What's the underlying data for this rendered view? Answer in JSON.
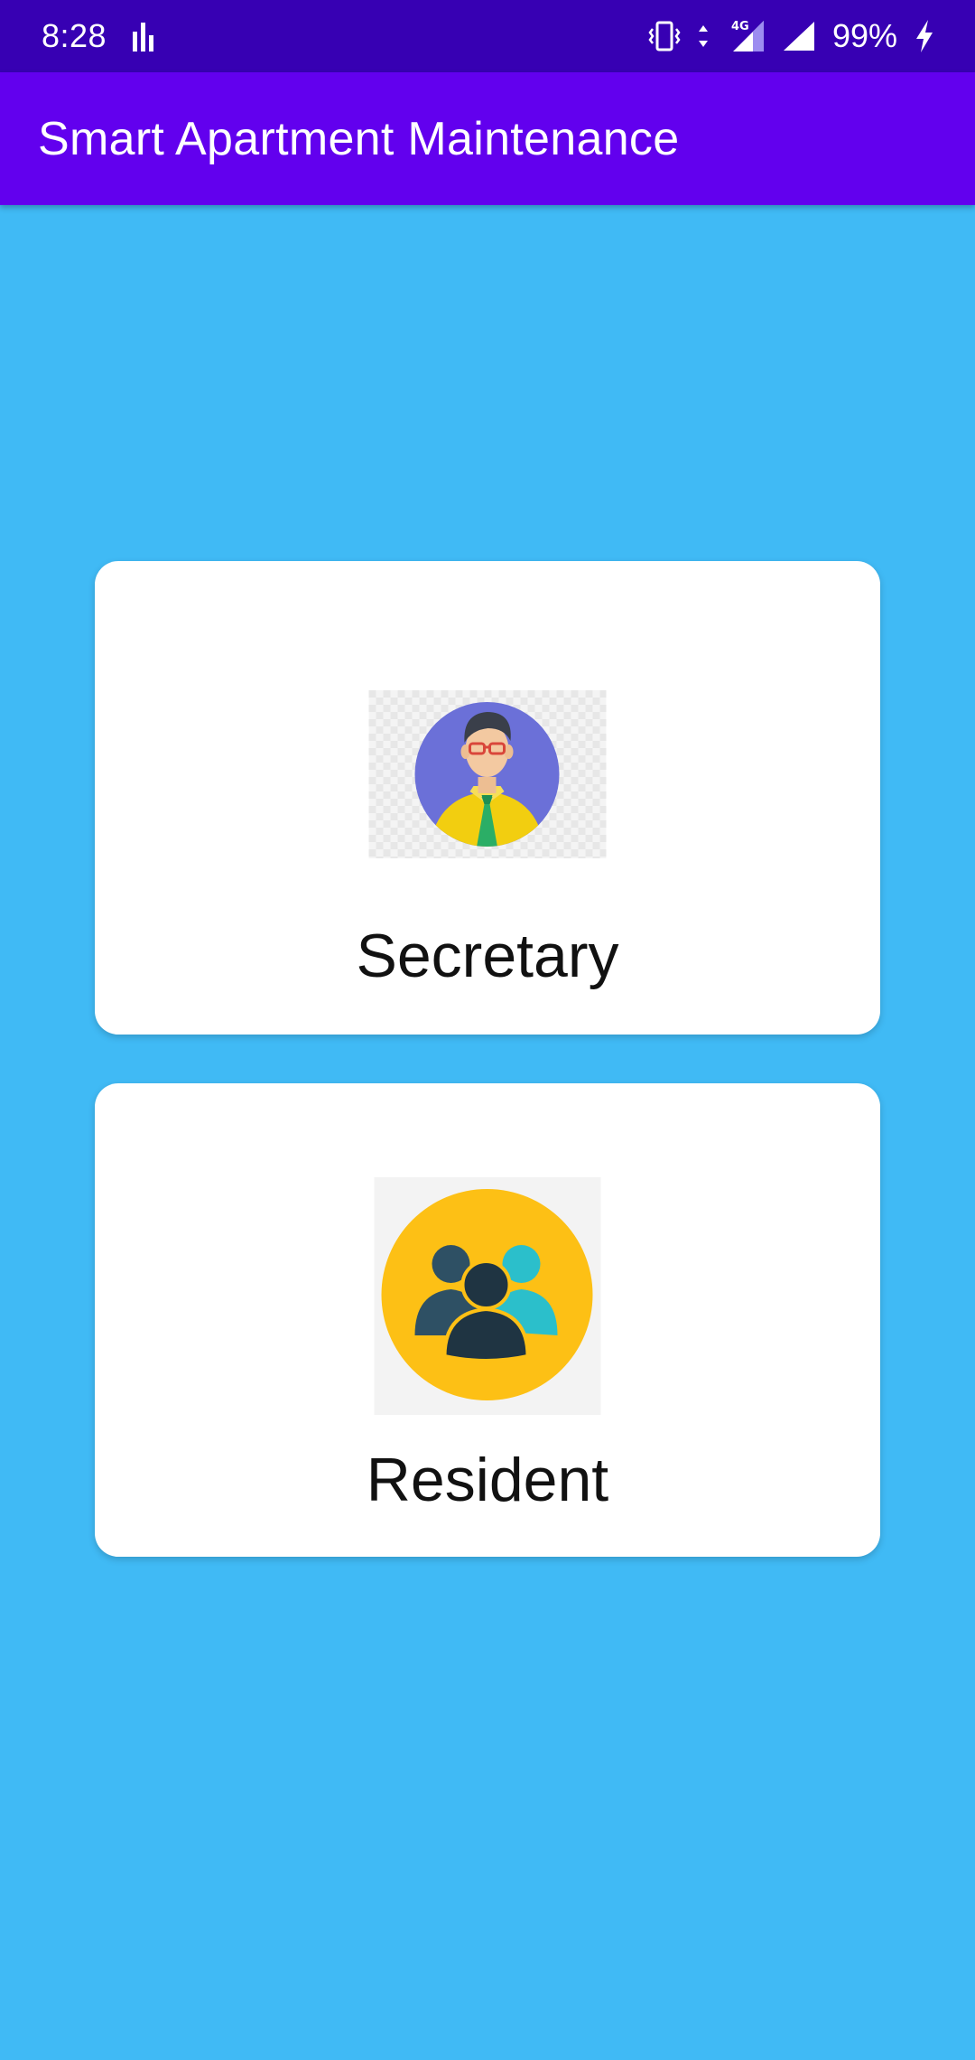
{
  "status_bar": {
    "time": "8:28",
    "battery": "99%",
    "network": "4G",
    "icons": [
      "sound-bars-icon",
      "vibrate-icon",
      "data-arrows-icon",
      "signal-4g-icon",
      "signal-icon",
      "charging-icon"
    ]
  },
  "app_bar": {
    "title": "Smart Apartment Maintenance",
    "color": "#6200EE"
  },
  "colors": {
    "background": "#40BAF5",
    "status_bar": "#3700B3",
    "card": "#FFFFFF"
  },
  "roles": [
    {
      "label": "Secretary",
      "icon": "secretary-avatar-icon"
    },
    {
      "label": "Resident",
      "icon": "residents-group-icon"
    }
  ]
}
